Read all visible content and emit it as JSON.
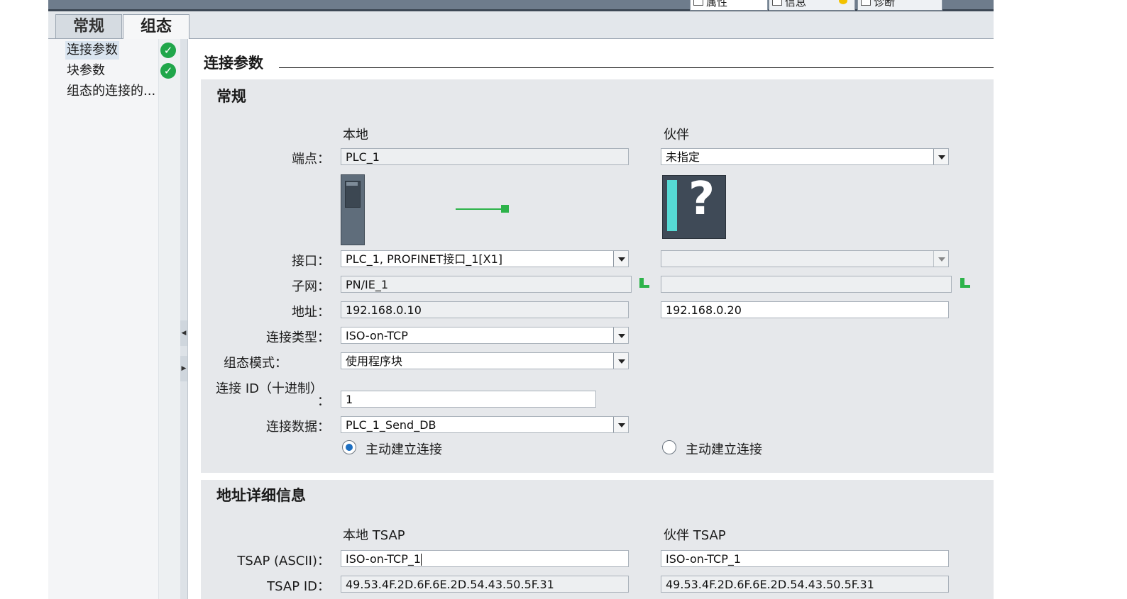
{
  "window": {
    "top_tabs": [
      {
        "label": "属性",
        "icon": "properties-icon"
      },
      {
        "label": "信息",
        "icon": "info-icon"
      },
      {
        "label": "诊断",
        "icon": "diagnostics-icon"
      }
    ]
  },
  "tabs": [
    {
      "label": "常规",
      "active": false
    },
    {
      "label": "组态",
      "active": true
    }
  ],
  "sidebar": {
    "items": [
      {
        "label": "连接参数",
        "selected": true,
        "status": "ok"
      },
      {
        "label": "块参数",
        "selected": false,
        "status": "ok"
      },
      {
        "label": "组态的连接的...",
        "selected": false,
        "status": ""
      }
    ]
  },
  "page": {
    "title": "连接参数"
  },
  "general": {
    "title": "常规",
    "local_header": "本地",
    "partner_header": "伙伴",
    "labels": {
      "endpoint": "端点：",
      "interface": "接口：",
      "subnet": "子网：",
      "address": "地址：",
      "connection_type": "连接类型：",
      "config_mode": "组态模式：",
      "connection_id_line1": "连接 ID（十进制）",
      "connection_id_line2": "：",
      "connection_data": "连接数据："
    },
    "local": {
      "endpoint": "PLC_1",
      "interface": "PLC_1, PROFINET接口_1[X1]",
      "subnet": "PN/IE_1",
      "address": "192.168.0.10",
      "connection_type": "ISO-on-TCP",
      "config_mode": "使用程序块",
      "connection_id": "1",
      "connection_data": "PLC_1_Send_DB",
      "active_connect_label": "主动建立连接",
      "active_connect_checked": true
    },
    "partner": {
      "endpoint": "未指定",
      "interface": "",
      "subnet": "",
      "address": "192.168.0.20",
      "active_connect_label": "主动建立连接",
      "active_connect_checked": false,
      "unknown_device_glyph": "?"
    }
  },
  "address_details": {
    "title": "地址详细信息",
    "local_header": "本地 TSAP",
    "partner_header": "伙伴 TSAP",
    "labels": {
      "tsap_ascii": "TSAP (ASCII)：",
      "tsap_id": "TSAP ID："
    },
    "local": {
      "tsap_ascii": "ISO-on-TCP_1",
      "tsap_id": "49.53.4F.2D.6F.6E.2D.54.43.50.5F.31"
    },
    "partner": {
      "tsap_ascii": "ISO-on-TCP_1",
      "tsap_id": "49.53.4F.2D.6F.6E.2D.54.43.50.5F.31"
    }
  },
  "colors": {
    "panel_bg": "#e6e8eb",
    "check_green": "#1fa64a",
    "link_green": "#2db34a",
    "radio_blue": "#1d6fc2",
    "device_teal": "#56d9d4"
  }
}
